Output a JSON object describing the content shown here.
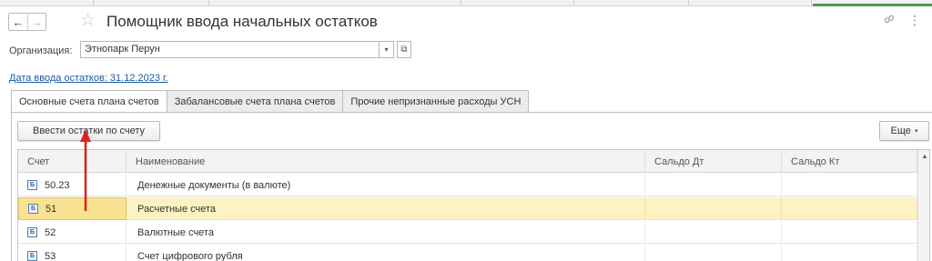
{
  "header": {
    "back_label": "←",
    "forward_label": "→",
    "star_glyph": "☆",
    "title": "Помощник ввода начальных остатков",
    "link_glyph": "🔗",
    "more_glyph": "⋮"
  },
  "organization": {
    "label": "Организация:",
    "value": "Этнопарк Перун",
    "dropdown_glyph": "▾",
    "open_glyph": "⧉"
  },
  "date_link": "Дата ввода остатков: 31.12.2023 г.",
  "tabs": [
    {
      "label": "Основные счета плана счетов",
      "active": true
    },
    {
      "label": "Забалансовые счета плана счетов",
      "active": false
    },
    {
      "label": "Прочие непризнанные расходы УСН",
      "active": false
    }
  ],
  "toolbar": {
    "enter_button": "Ввести остатки по счету",
    "more_button": "Еще",
    "more_caret": "▾"
  },
  "table": {
    "columns": [
      "Счет",
      "Наименование",
      "Сальдо Дт",
      "Сальдо Кт"
    ],
    "rows": [
      {
        "code": "50.23",
        "name": "Денежные документы (в валюте)",
        "debit": "",
        "credit": "",
        "selected": false
      },
      {
        "code": "51",
        "name": "Расчетные счета",
        "debit": "",
        "credit": "",
        "selected": true
      },
      {
        "code": "52",
        "name": "Валютные счета",
        "debit": "",
        "credit": "",
        "selected": false
      },
      {
        "code": "53",
        "name": "Счет цифрового рубля",
        "debit": "",
        "credit": "",
        "selected": false
      }
    ],
    "row_icon": "Б",
    "scroll_up_glyph": "▲"
  },
  "colors": {
    "accent_link": "#1b5aa3",
    "selected_row": "#fcf2c2",
    "selected_cell": "#f9e291",
    "annotation_arrow": "#e02020"
  }
}
